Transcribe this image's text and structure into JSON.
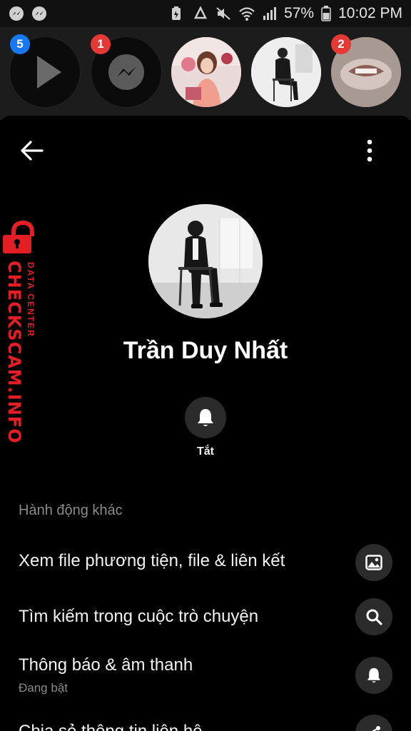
{
  "status_bar": {
    "battery": "57%",
    "time": "10:02 PM",
    "left_icons": [
      "messenger-icon",
      "messenger-icon"
    ],
    "right_icons": [
      "battery-saver-icon",
      "recycle-icon",
      "mute-icon",
      "wifi-icon",
      "signal-icon",
      "battery-icon"
    ]
  },
  "bubbles": {
    "items": [
      {
        "name": "play-bubble",
        "badge": "5",
        "badge_color": "#1877f2"
      },
      {
        "name": "messenger-bubble",
        "badge": "1",
        "badge_color": "#e53935"
      },
      {
        "name": "contact-bubble-1",
        "badge": ""
      },
      {
        "name": "contact-bubble-2",
        "badge": ""
      },
      {
        "name": "contact-bubble-3",
        "badge": "2",
        "badge_color": "#e53935"
      }
    ]
  },
  "header": {
    "back_icon": "arrow-left-icon",
    "more_icon": "more-vertical-icon"
  },
  "profile": {
    "name": "Trần Duy Nhất"
  },
  "mute_action": {
    "icon": "bell-icon",
    "label": "Tắt"
  },
  "more_actions": {
    "title": "Hành động khác",
    "items": [
      {
        "label": "Xem file phương tiện, file & liên kết",
        "icon": "image-icon"
      },
      {
        "label": "Tìm kiếm trong cuộc trò chuyện",
        "icon": "search-icon"
      },
      {
        "label": "Thông báo & âm thanh",
        "sub": "Đang bật",
        "icon": "bell-icon"
      },
      {
        "label": "Chia sẻ thông tin liên hệ",
        "icon": "share-icon"
      }
    ]
  },
  "watermark": {
    "main": "CHECKSCAM.INFO",
    "sub": "DATA CENTER"
  },
  "colors": {
    "background": "#000000",
    "icon_circle": "#2b2b2b",
    "muted_text": "#8a8a8a",
    "watermark_red": "#e31e24"
  }
}
